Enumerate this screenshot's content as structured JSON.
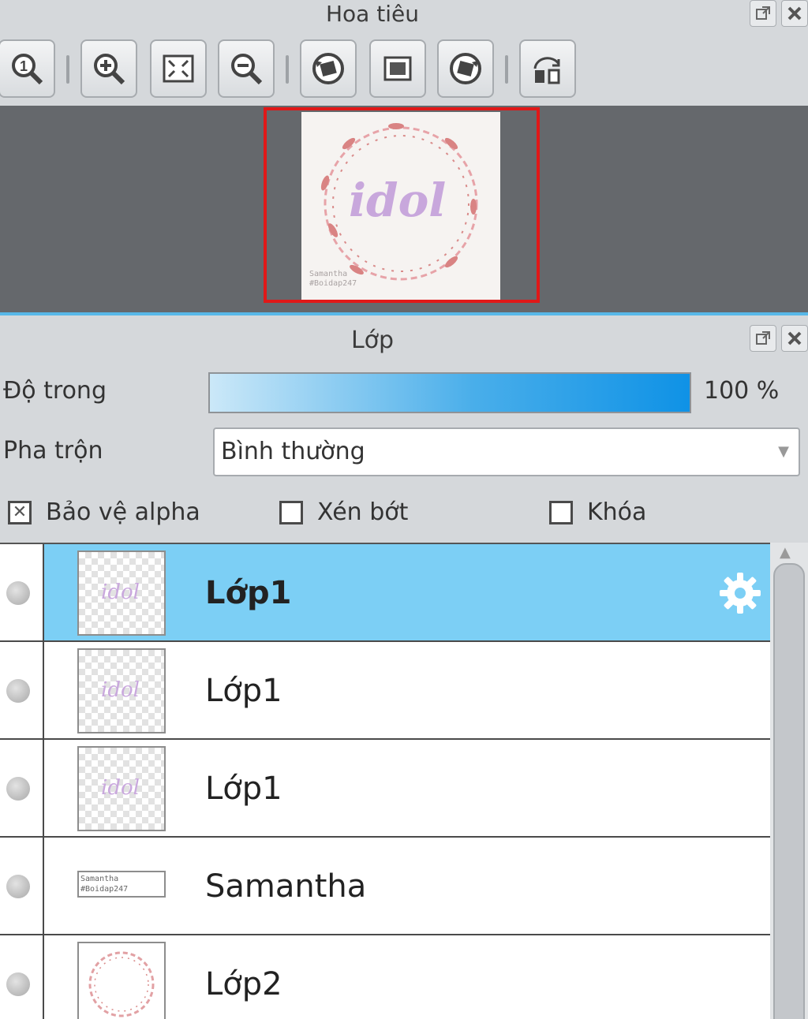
{
  "navigator": {
    "title": "Hoa tiêu",
    "toolbar": [
      {
        "name": "zoom-actual-size-button",
        "icon": "zoom-1x-icon"
      },
      {
        "name": "zoom-in-button",
        "icon": "zoom-in-icon"
      },
      {
        "name": "fit-to-window-button",
        "icon": "fit-screen-icon"
      },
      {
        "name": "zoom-out-button",
        "icon": "zoom-out-icon"
      },
      {
        "name": "rotate-left-button",
        "icon": "rotate-left-icon"
      },
      {
        "name": "reset-view-button",
        "icon": "reset-view-icon"
      },
      {
        "name": "rotate-right-button",
        "icon": "rotate-right-icon"
      },
      {
        "name": "flip-horizontal-button",
        "icon": "flip-horizontal-icon"
      }
    ],
    "preview": {
      "word": "idol",
      "signature": "Samantha\n#Boidap247"
    }
  },
  "layer_panel": {
    "title": "Lớp",
    "opacity_label": "Độ trong",
    "opacity_value": "100 %",
    "opacity_fraction": 1.0,
    "blend_label": "Pha trộn",
    "blend_value": "Bình thường",
    "checkboxes": {
      "protect_alpha": {
        "label": "Bảo vệ alpha",
        "checked": true
      },
      "clipping": {
        "label": "Xén bớt",
        "checked": false
      },
      "lock": {
        "label": "Khóa",
        "checked": false
      }
    },
    "layers": [
      {
        "name": "Lớp1",
        "selected": true,
        "thumb": "idol"
      },
      {
        "name": "Lớp1",
        "selected": false,
        "thumb": "idol"
      },
      {
        "name": "Lớp1",
        "selected": false,
        "thumb": "idol"
      },
      {
        "name": "Samantha",
        "selected": false,
        "thumb": "Samantha\n#Boidap247"
      },
      {
        "name": "Lớp2",
        "selected": false,
        "thumb": ""
      }
    ]
  },
  "colors": {
    "selected_row": "#7ccff5",
    "nav_frame": "#e01818",
    "opacity_bar": "#0f92e6"
  }
}
